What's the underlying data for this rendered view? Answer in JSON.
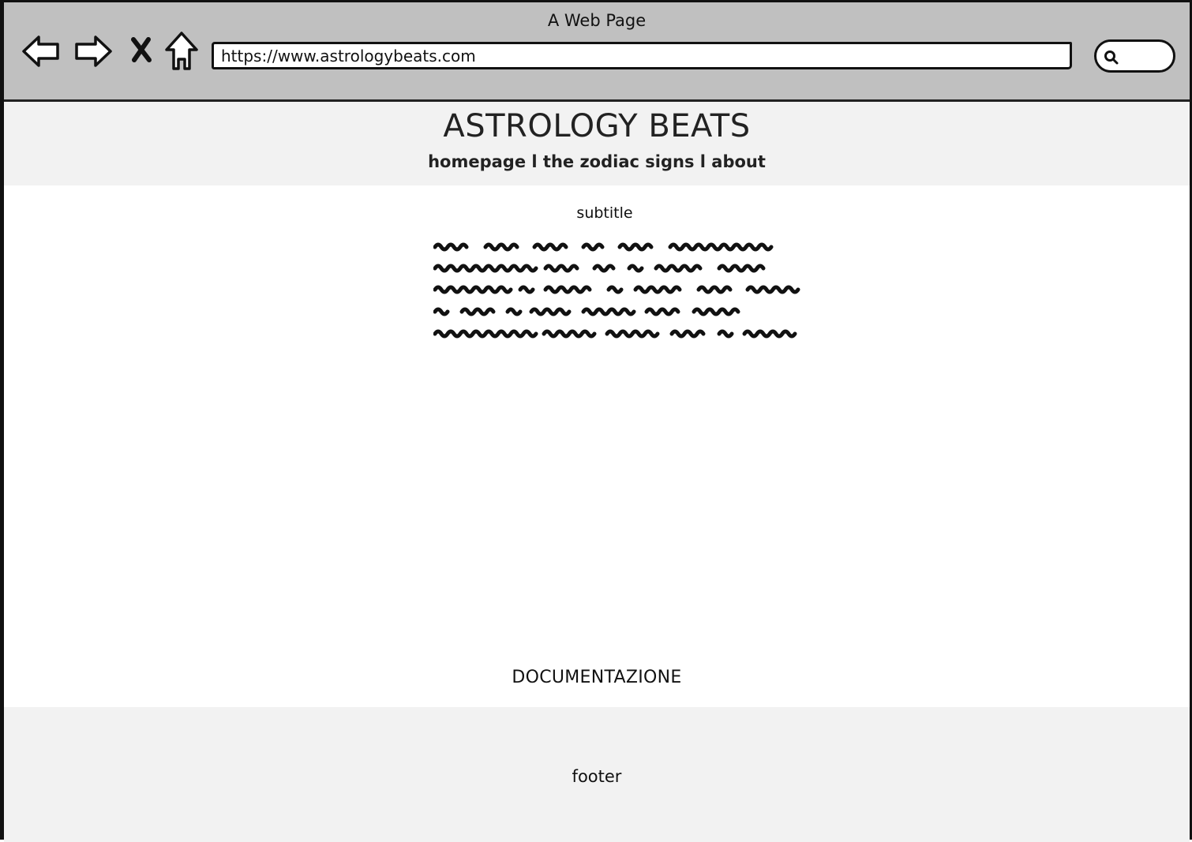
{
  "browser": {
    "window_title": "A Web Page",
    "url": "https://www.astrologybeats.com",
    "icons": {
      "back": "back-arrow-icon",
      "forward": "forward-arrow-icon",
      "stop": "close-icon",
      "home": "home-icon",
      "search": "search-icon"
    }
  },
  "site": {
    "title": "ASTROLOGY BEATS",
    "nav": {
      "home": "homepage",
      "separator1": " l ",
      "zodiac": "the zodiac signs",
      "separator2": " l ",
      "about": "about"
    }
  },
  "main": {
    "subtitle": "subtitle",
    "placeholder_text": "scribbled-placeholder-paragraph",
    "documentation_label": "DOCUMENTAZIONE"
  },
  "footer": {
    "label": "footer"
  },
  "colors": {
    "chrome_bg": "#c0c0c0",
    "header_bg": "#f2f2f2",
    "footer_bg": "#f2f2f2",
    "page_bg": "#ffffff"
  }
}
